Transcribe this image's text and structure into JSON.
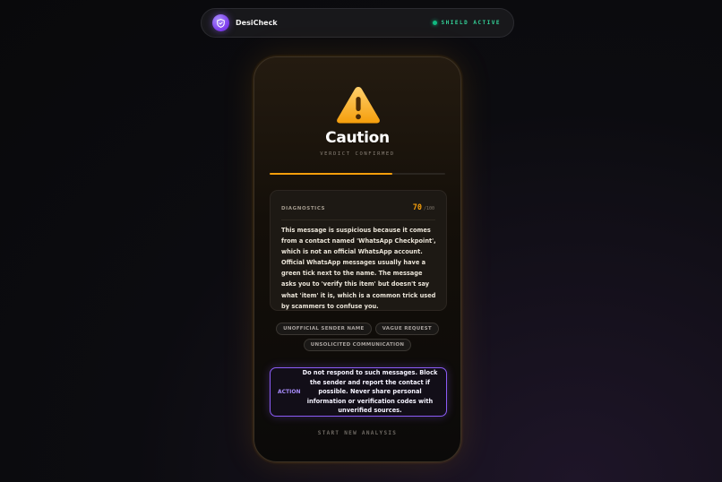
{
  "header": {
    "brand": "DesiCheck",
    "status": "SHIELD ACTIVE",
    "icons": {
      "logo": "shield-icon",
      "status": "status-dot"
    }
  },
  "result": {
    "warning_icon": "warning-triangle-icon",
    "verdict": "Caution",
    "verdict_sub": "VERDICT CONFIRMED",
    "risk_fraction": 0.7
  },
  "diagnostics": {
    "title": "DIAGNOSTICS",
    "score": "70",
    "score_max": "/100",
    "text": "This message is suspicious because it comes from a contact named 'WhatsApp Checkpoint', which is not an official WhatsApp account. Official WhatsApp messages usually have a green tick next to the name. The message asks you to 'verify this item' but doesn't say what 'item' it is, which is a common trick used by scammers to confuse you."
  },
  "tags": [
    "UNOFFICIAL SENDER NAME",
    "VAGUE REQUEST",
    "UNSOLICITED COMMUNICATION"
  ],
  "action": {
    "label": "ACTION",
    "text": "Do not respond to such messages. Block the sender and report the contact if possible. Never share personal information or verification codes with unverified sources."
  },
  "restart_label": "START NEW ANALYSIS",
  "colors": {
    "accent_warning": "#f59e0b",
    "accent_action": "#8b5cf6",
    "status_active": "#10b981"
  }
}
